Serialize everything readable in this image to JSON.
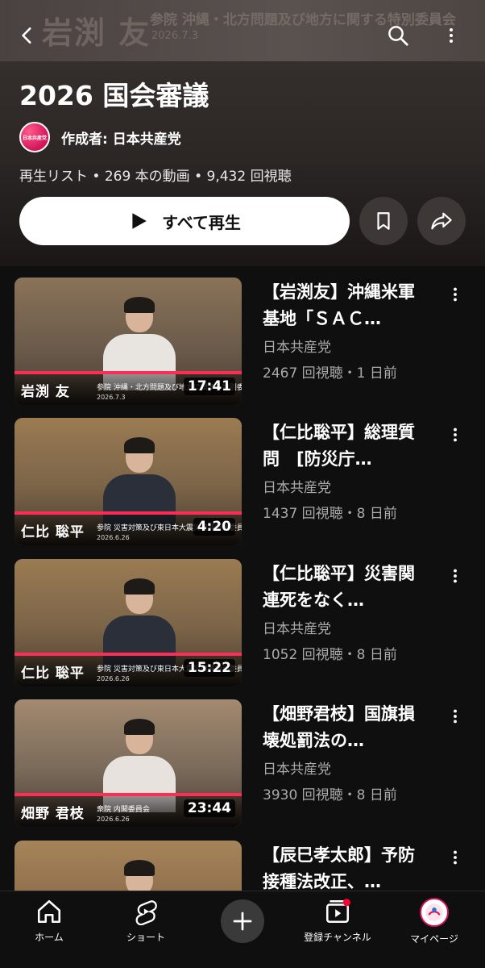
{
  "banner": {
    "name": "岩渕 友",
    "committee": "参院 沖縄・北方問題及び地方に関する特別委員会",
    "date": "2026.7.3"
  },
  "icons": {
    "back": "back-arrow-icon",
    "search": "search-icon",
    "more": "more-vert-icon",
    "save": "bookmark-icon",
    "share": "share-icon",
    "play": "play-icon"
  },
  "playlist": {
    "title": "2026 国会審議",
    "channel_logo_text": "日本共産党",
    "channel_label": "作成者: 日本共産党",
    "meta": "再生リスト • 269 本の動画 • 9,432 回視聴",
    "play_all_label": "すべて再生"
  },
  "videos": [
    {
      "title": "【岩渕友】沖縄米軍基地「ＳＡＣ…",
      "channel": "日本共産党",
      "meta": "2467 回視聴・1 日前",
      "duration": "17:41",
      "thumb_name": "岩渕 友",
      "thumb_committee": "参院 沖縄・北方問題及び地方に関する特別委員会",
      "thumb_date": "2026.7.3",
      "watched": 0.0
    },
    {
      "title": "【仁比聡平】総理質問　[防災庁…",
      "channel": "日本共産党",
      "meta": "1437 回視聴・8 日前",
      "duration": "4:20",
      "thumb_name": "仁比 聡平",
      "thumb_committee": "参院 災害対策及び東日本大震災復興特別委員会",
      "thumb_date": "2026.6.26",
      "watched": 0.0
    },
    {
      "title": "【仁比聡平】災害関連死をなく…",
      "channel": "日本共産党",
      "meta": "1052 回視聴・8 日前",
      "duration": "15:22",
      "thumb_name": "仁比 聡平",
      "thumb_committee": "参院 災害対策及び東日本大震災復興特別委員会",
      "thumb_date": "2026.6.26",
      "watched": 0.0
    },
    {
      "title": "【畑野君枝】国旗損壊処罰法の…",
      "channel": "日本共産党",
      "meta": "3930 回視聴・8 日前",
      "duration": "23:44",
      "thumb_name": "畑野 君枝",
      "thumb_committee": "衆院 内閣委員会",
      "thumb_date": "2026.6.26",
      "watched": 0.0
    },
    {
      "title": "【辰巳孝太郎】予防接種法改正、…",
      "channel": "",
      "meta": "",
      "duration": "",
      "thumb_name": "",
      "thumb_committee": "",
      "thumb_date": "",
      "watched": 0.0
    }
  ],
  "nav": {
    "home": "ホーム",
    "shorts": "ショート",
    "subscriptions": "登録チャンネル",
    "mypage": "マイページ"
  },
  "colors": {
    "accent": "#ff2d55",
    "background": "#0f0f0f",
    "header": "#3a3330",
    "party_red": "#d4145a"
  }
}
